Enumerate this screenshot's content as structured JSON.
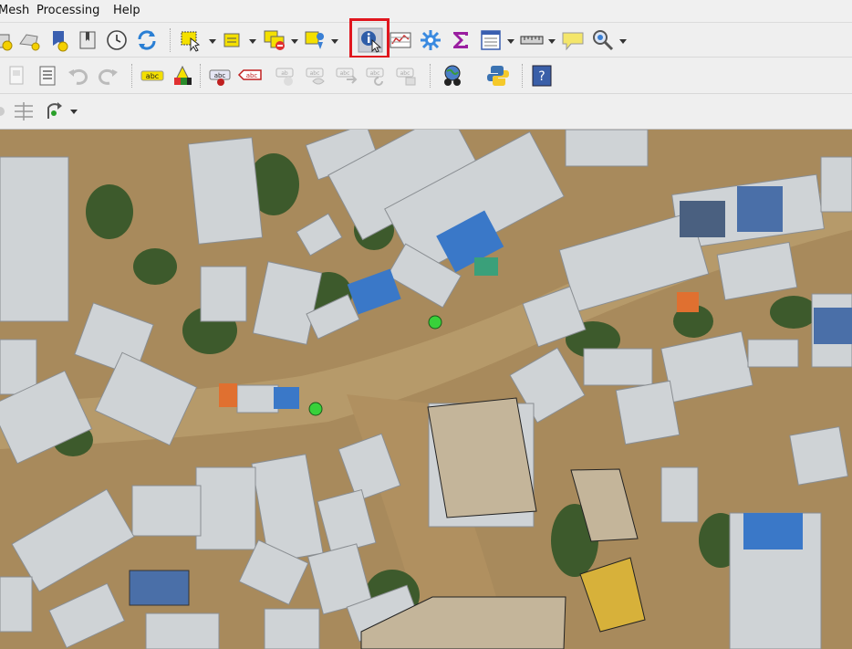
{
  "menubar": {
    "items": [
      "Mesh",
      "Processing",
      "Help"
    ]
  },
  "toolbar_row1": {
    "icons": [
      "new-mesh-layer-icon",
      "new-virtual-layer-icon",
      "new-temporary-layer-icon",
      "bookmark-icon",
      "temporal-controller-icon",
      "refresh-icon",
      "select-features-icon",
      "attribute-table-icon",
      "deselect-icon",
      "select-by-location-icon",
      "identify-features-icon",
      "open-attribute-table-icon",
      "toolbox-icon",
      "statistics-sum-icon",
      "field-calculator-icon",
      "measure-line-icon",
      "map-tips-icon",
      "zoom-icon"
    ],
    "highlighted": "identify-features-icon",
    "highlight_color": "#e0161e"
  },
  "toolbar_row2": {
    "icons": [
      "new-print-layout-icon",
      "layout-manager-icon",
      "undo-icon",
      "redo-icon",
      "label-abc-icon",
      "label-style-icon",
      "pin-label-icon",
      "remove-label-icon",
      "label-a-icon",
      "label-b-icon",
      "label-c-icon",
      "label-d-icon",
      "label-e-icon",
      "globe-plugin-icon",
      "python-console-icon",
      "help-book-icon"
    ],
    "label_text": "abc"
  },
  "toolbar_row3": {
    "icons": [
      "snapping-icon",
      "advanced-digitizing-icon",
      "rotate-icon"
    ]
  },
  "map": {
    "colors": {
      "ground": "#a88a5c",
      "building_polygon": "#c4b59a",
      "selected_polygon": "#d7b13a",
      "point": "#38d13a",
      "roof": "#cfd3d6"
    }
  }
}
